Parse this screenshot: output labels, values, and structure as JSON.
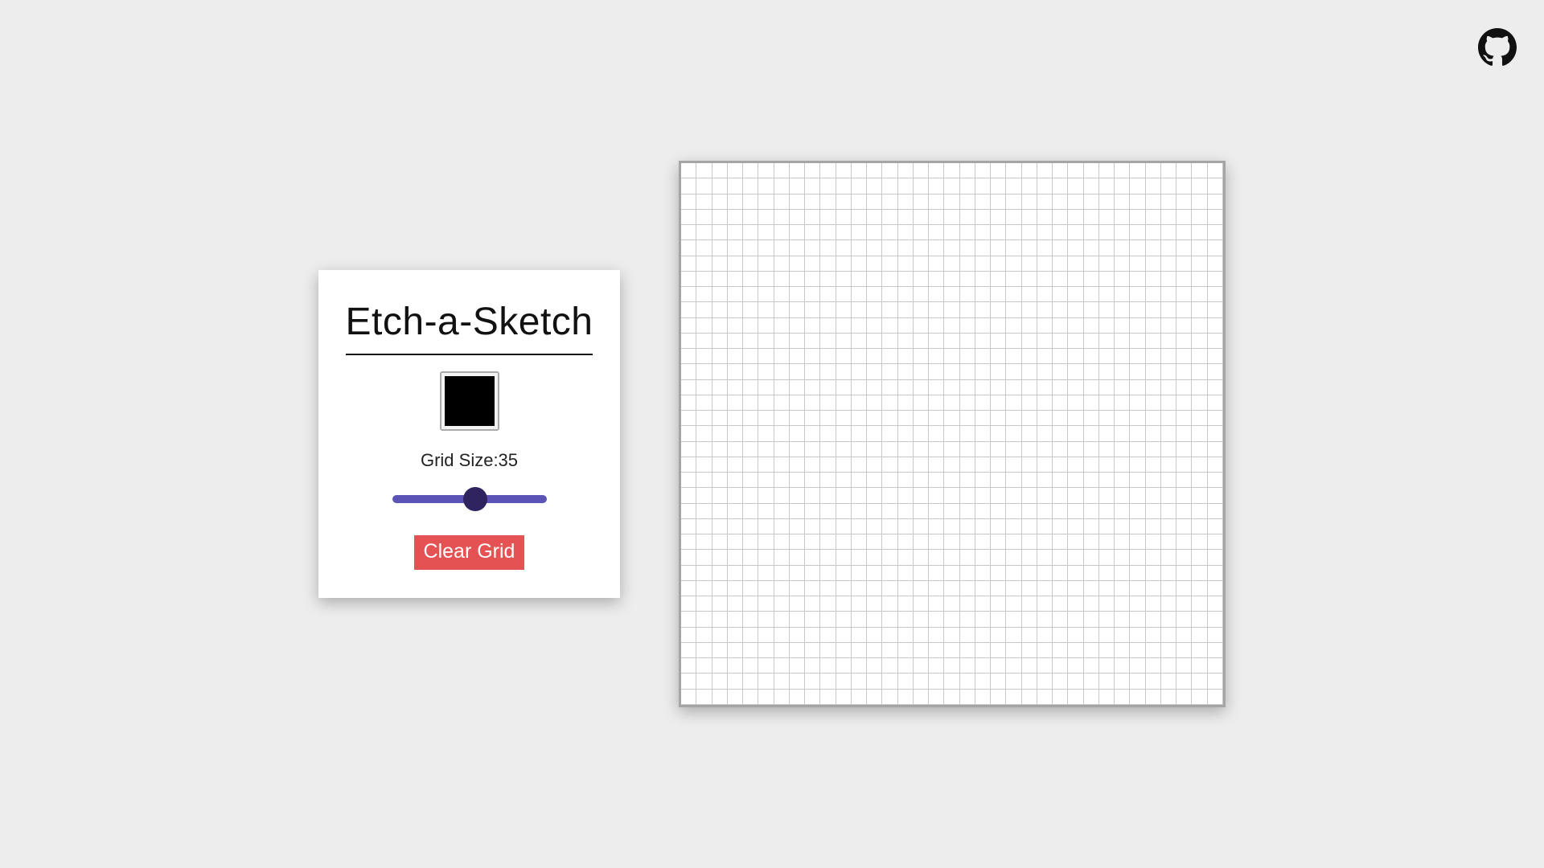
{
  "app": {
    "title": "Etch-a-Sketch"
  },
  "github": {
    "icon": "github-icon"
  },
  "color_picker": {
    "value": "#000000"
  },
  "grid_size": {
    "label": "Grid Size:35",
    "value": 35,
    "min": 1,
    "max": 64
  },
  "controls": {
    "clear_label": "Clear Grid"
  },
  "colors": {
    "background": "#ededed",
    "panel": "#ffffff",
    "slider_track": "#5b53b6",
    "slider_thumb": "#2f2460",
    "clear_button": "#e45254",
    "grid_line": "#c8c8c8"
  }
}
